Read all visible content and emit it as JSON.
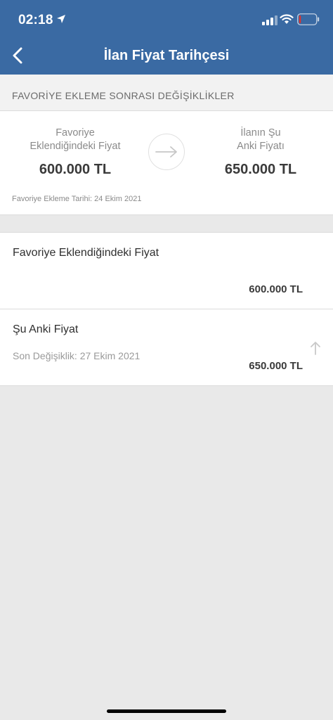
{
  "status_bar": {
    "time": "02:18",
    "icons": [
      "location-arrow-icon",
      "signal-icon",
      "wifi-icon",
      "battery-icon"
    ]
  },
  "nav": {
    "title": "İlan Fiyat Tarihçesi",
    "back_icon": "chevron-left-icon"
  },
  "section": {
    "title": "FAVORİYE EKLEME SONRASI DEĞİŞİKLİKLER"
  },
  "comparison": {
    "left_label_line1": "Favoriye",
    "left_label_line2": "Eklendiğindeki Fiyat",
    "left_price": "600.000 TL",
    "right_label_line1": "İlanın Şu",
    "right_label_line2": "Anki Fiyatı",
    "right_price": "650.000 TL",
    "date_note": "Favoriye Ekleme Tarihi: 24 Ekim 2021",
    "arrow_icon": "arrow-right-icon"
  },
  "rows": [
    {
      "title": "Favoriye Eklendiğindeki Fiyat",
      "subtitle": "",
      "price": "600.000 TL"
    },
    {
      "title": "Şu Anki Fiyat",
      "subtitle": "Son Değişiklik: 27 Ekim 2021",
      "price": "650.000 TL",
      "trend_icon": "arrow-up-icon"
    }
  ],
  "colors": {
    "header_bg": "#3a6aa3",
    "section_bg": "#f2f2f2",
    "page_bg": "#e9e9e9"
  }
}
